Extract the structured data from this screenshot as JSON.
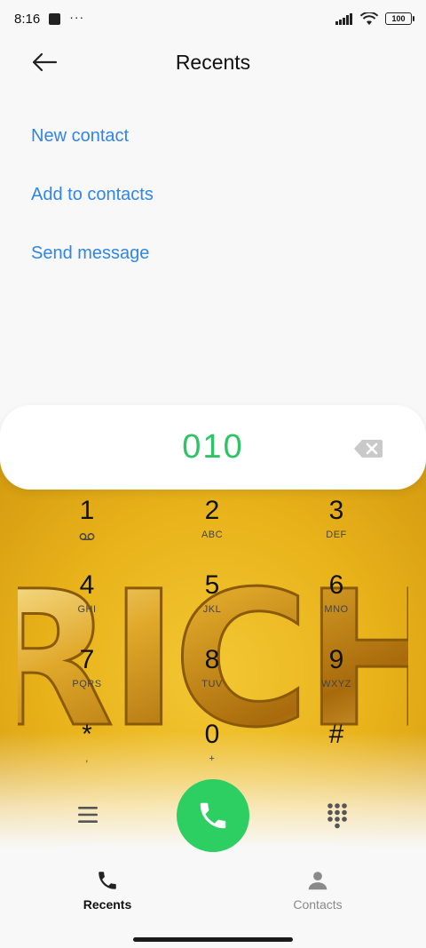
{
  "status_bar": {
    "time": "8:16",
    "dots": "···",
    "battery": "100"
  },
  "header": {
    "title": "Recents"
  },
  "actions": [
    {
      "label": "New contact"
    },
    {
      "label": "Add to contacts"
    },
    {
      "label": "Send message"
    }
  ],
  "dialer": {
    "number": "010"
  },
  "keys": [
    {
      "digit": "1",
      "letters": ""
    },
    {
      "digit": "2",
      "letters": "ABC"
    },
    {
      "digit": "3",
      "letters": "DEF"
    },
    {
      "digit": "4",
      "letters": "GHI"
    },
    {
      "digit": "5",
      "letters": "JKL"
    },
    {
      "digit": "6",
      "letters": "MNO"
    },
    {
      "digit": "7",
      "letters": "PQRS"
    },
    {
      "digit": "8",
      "letters": "TUV"
    },
    {
      "digit": "9",
      "letters": "WXYZ"
    },
    {
      "digit": "*",
      "letters": ","
    },
    {
      "digit": "0",
      "letters": "+"
    },
    {
      "digit": "#",
      "letters": ""
    }
  ],
  "wallpaper_text": "RICH",
  "bottom_nav": {
    "recents": "Recents",
    "contacts": "Contacts"
  },
  "colors": {
    "accent_blue": "#2f86e6",
    "call_green": "#2dce62",
    "number_green": "#2ec466"
  }
}
